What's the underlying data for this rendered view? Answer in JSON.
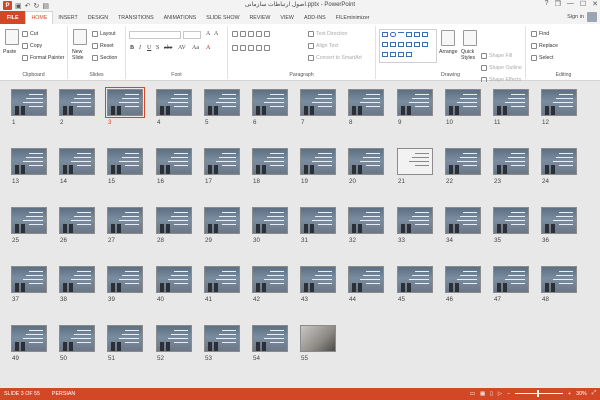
{
  "window": {
    "title": "اصول ارتباطات سازمانی.pptx - PowerPoint",
    "app_icon": "P",
    "quick_access": [
      "save-icon",
      "undo-icon",
      "redo-icon",
      "start-from-beginning-icon"
    ],
    "controls": [
      "?",
      "❐",
      "—",
      "☐",
      "✕"
    ]
  },
  "tabs": [
    {
      "label": "FILE"
    },
    {
      "label": "HOME"
    },
    {
      "label": "INSERT"
    },
    {
      "label": "DESIGN"
    },
    {
      "label": "TRANSITIONS"
    },
    {
      "label": "ANIMATIONS"
    },
    {
      "label": "SLIDE SHOW"
    },
    {
      "label": "REVIEW"
    },
    {
      "label": "VIEW"
    },
    {
      "label": "ADD-INS"
    },
    {
      "label": "FILEminimizer"
    }
  ],
  "active_tab": "HOME",
  "sign_in": "Sign in",
  "ribbon": {
    "clipboard": {
      "paste": "Paste",
      "cut": "Cut",
      "copy": "Copy",
      "format_painter": "Format Painter",
      "label": "Clipboard"
    },
    "slides": {
      "new_slide": "New Slide",
      "layout": "Layout",
      "reset": "Reset",
      "section": "Section",
      "label": "Slides"
    },
    "font": {
      "label": "Font",
      "bold": "B",
      "italic": "I",
      "underline": "U",
      "strike": "S",
      "shadow": "abc",
      "spacing": "AV",
      "case": "Aa",
      "color": "A"
    },
    "paragraph": {
      "text_direction": "Text Direction",
      "align_text": "Align Text",
      "convert_smartart": "Convert to SmartArt",
      "label": "Paragraph"
    },
    "drawing": {
      "arrange": "Arrange",
      "quick_styles": "Quick Styles",
      "shape_fill": "Shape Fill",
      "shape_outline": "Shape Outline",
      "shape_effects": "Shape Effects",
      "label": "Drawing"
    },
    "editing": {
      "find": "Find",
      "replace": "Replace",
      "select": "Select",
      "label": "Editing"
    }
  },
  "slides": {
    "count": 55,
    "selected": 3,
    "white_slides": [
      21
    ],
    "photo_slides": [
      55
    ]
  },
  "status": {
    "slide_info": "SLIDE 3 OF 55",
    "language": "PERSIAN",
    "zoom": "30%",
    "zoom_minus": "−",
    "zoom_plus": "+"
  }
}
